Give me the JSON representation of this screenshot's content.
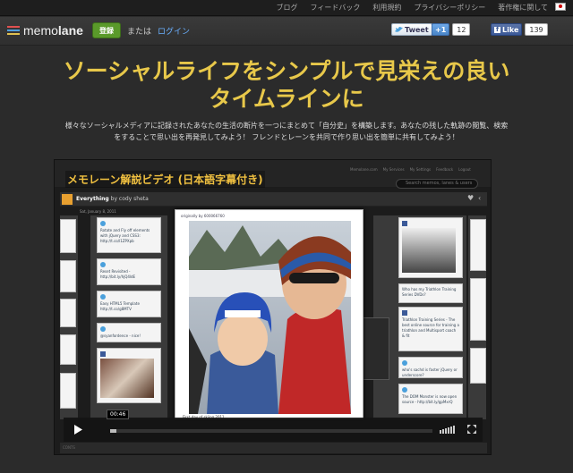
{
  "topnav": {
    "items": [
      "ブログ",
      "フィードバック",
      "利用規約",
      "プライバシーポリシー",
      "著作権に関して"
    ]
  },
  "header": {
    "logo_pre": "memo",
    "logo_bold": "lane",
    "register_label": "登録",
    "or_label": "または",
    "login_label": "ログイン",
    "tweet_label": "Tweet",
    "gplus_label": "+1",
    "gplus_count": "12",
    "like_label": "Like",
    "like_count": "139"
  },
  "hero": {
    "headline_line1": "ソーシャルライフをシンプルで見栄えの良い",
    "headline_line2": "タイムラインに",
    "desc_line1": "様々なソーシャルメディアに記録されたあなたの生活の断片を一つにまとめて「自分史」を構築します。あなたの残した軌跡の閲覧、検索",
    "desc_line2": "をすることで思い出を再発見してみよう！ フレンドとレーンを共同で作り思い出を簡単に共有してみよう！"
  },
  "video": {
    "title": "メモレーン解説ビデオ (日本語字幕付き)",
    "search_placeholder": "Search memos, lanes & users",
    "links": [
      "Memolane.com",
      "My Services",
      "My Settings",
      "Feedback",
      "Logout"
    ],
    "lane_name": "Everything",
    "lane_by": "by cody sheta",
    "date_label": "Sat, January 8, 2011",
    "time": "00:46",
    "progress": 0.02,
    "photo_caption": "First day of skiing 2011",
    "photo_head": "originally by 600066760",
    "footer_text": "CONTS",
    "cards": [
      {
        "text": "Rotate and Fly off elements with jQuery and CSS3: http://t.co/l1ZPXpb"
      },
      {
        "text": "Reset Revisited - http://bit.ly/hjQ4ldE"
      },
      {
        "text": "Easy HTML5 Template http://t.co/g8MTV"
      },
      {
        "text": "@syanfordence - nice!"
      },
      {
        "text": "Who has my Triathlon Training Series DVDs?"
      },
      {
        "text": "Triathlon Training Series - The best online source for training a triathlon and Multisport coach & fit"
      },
      {
        "text": "who's sachd is faster jQuery or underscore?"
      },
      {
        "text": "The DOM Monster is now open source - http://bit.ly/gpMxrQ"
      }
    ]
  },
  "colors": {
    "headline": "#e8c84a",
    "accent_green": "#5a9a2a",
    "link_blue": "#6ab0ff",
    "twitter_blue": "#4aa0dc"
  }
}
